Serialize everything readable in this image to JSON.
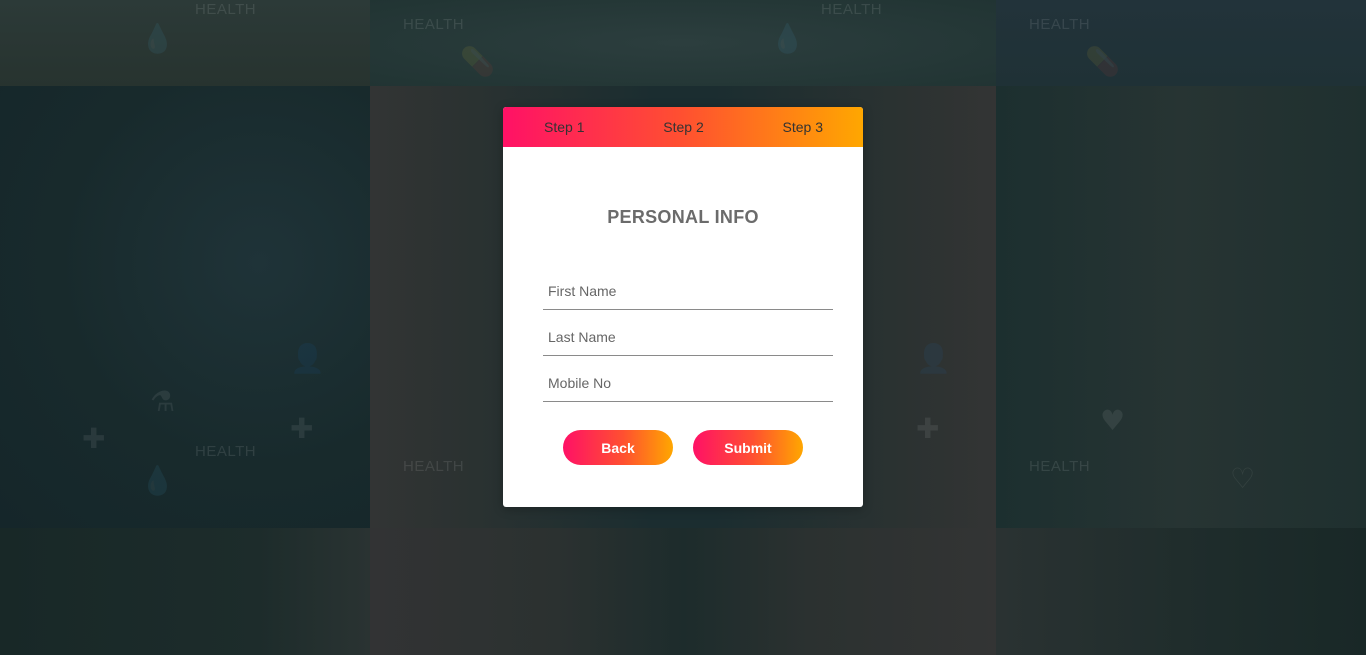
{
  "background": {
    "watermark_word": "HEALTH"
  },
  "steps": [
    {
      "label": "Step 1"
    },
    {
      "label": "Step 2"
    },
    {
      "label": "Step 3"
    }
  ],
  "form": {
    "title": "PERSONAL INFO",
    "fields": [
      {
        "placeholder": "First Name",
        "value": ""
      },
      {
        "placeholder": "Last Name",
        "value": ""
      },
      {
        "placeholder": "Mobile No",
        "value": ""
      }
    ],
    "back_label": "Back",
    "submit_label": "Submit"
  },
  "colors": {
    "gradient_start": "#ff1166",
    "gradient_mid": "#ff5030",
    "gradient_end": "#ffa700",
    "title_color": "#6b6b6b"
  }
}
